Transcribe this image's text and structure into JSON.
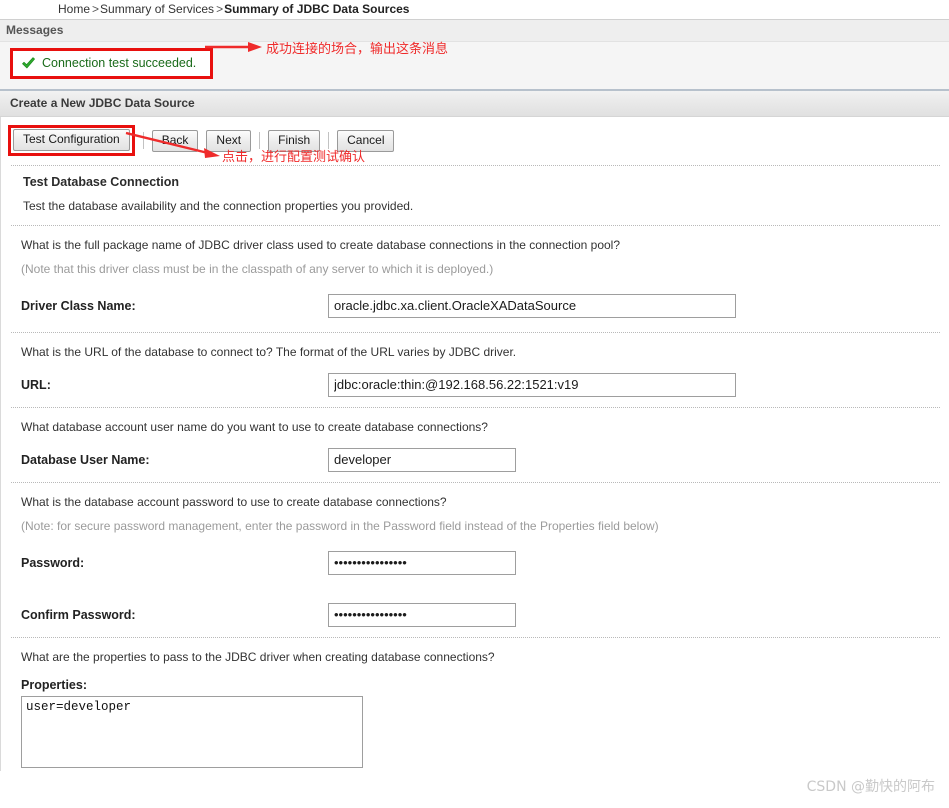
{
  "breadcrumb": {
    "items": [
      {
        "label": "Home",
        "current": false
      },
      {
        "label": "Summary of Services",
        "current": false
      },
      {
        "label": "Summary of JDBC Data Sources",
        "current": true
      }
    ],
    "separator": ">"
  },
  "messages": {
    "header": "Messages",
    "status_text": "Connection test succeeded.",
    "status_icon": "green-check-icon",
    "status_color": "#1a6b1a",
    "highlight_color": "#e8100e"
  },
  "section": {
    "title": "Create a New JDBC Data Source"
  },
  "toolbar": {
    "test_configuration_label": "Test Configuration",
    "back_label": "Back",
    "next_label": "Next",
    "finish_label": "Finish",
    "cancel_label": "Cancel"
  },
  "wizard": {
    "heading": "Test Database Connection",
    "description": "Test the database availability and the connection properties you provided."
  },
  "form": {
    "driver": {
      "question": "What is the full package name of JDBC driver class used to create database connections in the connection pool?",
      "note": "(Note that this driver class must be in the classpath of any server to which it is deployed.)",
      "label": "Driver Class Name:",
      "value": "oracle.jdbc.xa.client.OracleXADataSource"
    },
    "url": {
      "question": "What is the URL of the database to connect to? The format of the URL varies by JDBC driver.",
      "label": "URL:",
      "value": "jdbc:oracle:thin:@192.168.56.22:1521:v19"
    },
    "username": {
      "question": "What database account user name do you want to use to create database connections?",
      "label": "Database User Name:",
      "value": "developer"
    },
    "password": {
      "question": "What is the database account password to use to create database connections?",
      "note": "(Note: for secure password management, enter the password in the Password field instead of the Properties field below)",
      "label": "Password:",
      "value": "••••••••••••••••"
    },
    "confirm_password": {
      "label": "Confirm Password:",
      "value": "••••••••••••••••"
    },
    "properties": {
      "question": "What are the properties to pass to the JDBC driver when creating database connections?",
      "label": "Properties:",
      "value": "user=developer"
    }
  },
  "annotations": [
    {
      "text": "成功连接的场合，输出这条消息",
      "color": "#ef2b2b"
    },
    {
      "text": "点击，进行配置测试确认",
      "color": "#ef2b2b"
    }
  ],
  "watermark": {
    "text": "CSDN @勤快的阿布"
  }
}
